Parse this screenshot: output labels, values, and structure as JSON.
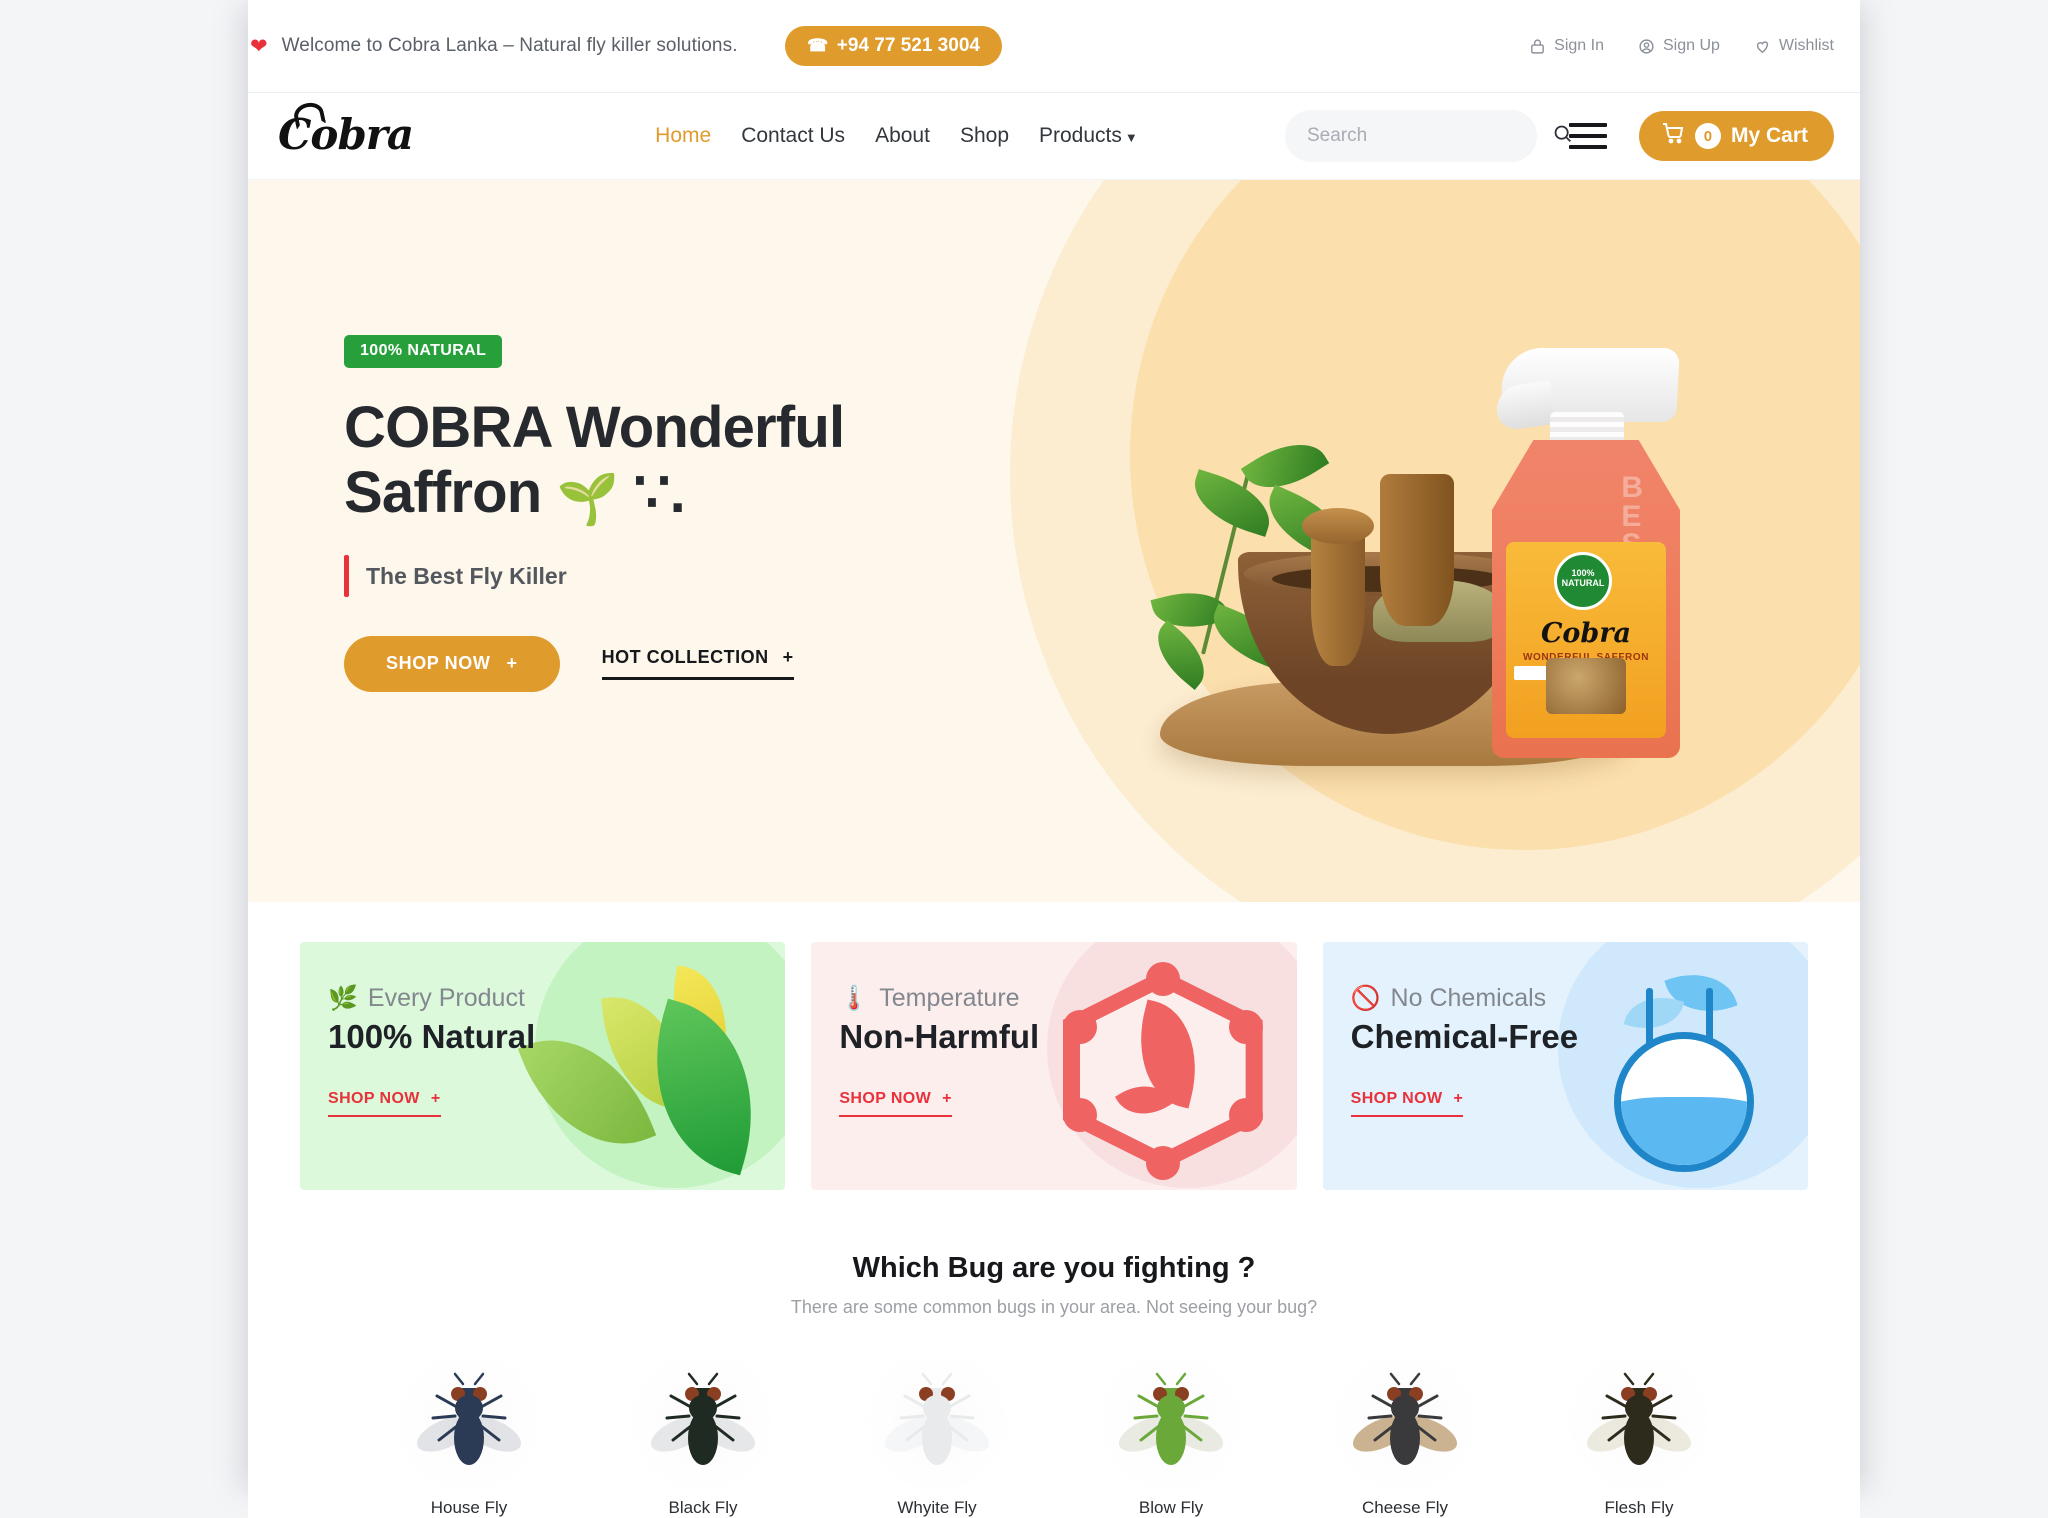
{
  "topbar": {
    "heart_icon": "heart-icon",
    "welcome": "Welcome to Cobra Lanka – Natural fly killer solutions.",
    "phone": "+94 77 521 3004",
    "links": [
      {
        "label": "Sign In",
        "icon": "lock-icon"
      },
      {
        "label": "Sign Up",
        "icon": "user-circle-icon"
      },
      {
        "label": "Wishlist",
        "icon": "heart-outline-icon"
      }
    ]
  },
  "nav": {
    "logo": "Cobra",
    "items": [
      {
        "label": "Home",
        "active": true
      },
      {
        "label": "Contact Us",
        "active": false
      },
      {
        "label": "About",
        "active": false
      },
      {
        "label": "Shop",
        "active": false
      },
      {
        "label": "Products",
        "active": false,
        "caret": "▼"
      }
    ],
    "products_caret": "▼",
    "search": {
      "placeholder": "Search",
      "value": "",
      "icon": "search-icon"
    },
    "menu_icon": "hamburger-icon",
    "cart": {
      "label": "My Cart",
      "count": "0",
      "icon": "cart-icon"
    }
  },
  "hero": {
    "badge": "100% NATURAL",
    "title_line1": "COBRA Wonderful",
    "title_line2": "Saffron",
    "title_emoji": "🌱",
    "title_suffix": "∵.",
    "subtitle": "The Best Fly Killer",
    "primary_cta": "SHOP NOW",
    "primary_cta_plus": "+",
    "secondary_cta": "HOT COLLECTION",
    "secondary_cta_plus": "+",
    "product": {
      "label_brand": "Cobra",
      "label_sub": "WONDERFUL SAFFRON",
      "label_badge": "100% NATURAL",
      "emboss": "BEST"
    }
  },
  "features": [
    {
      "kicker": "Every Product",
      "emoji": "🌿",
      "icon": "herb-icon",
      "title": "100% Natural",
      "cta": "SHOP NOW",
      "cta_plus": "+",
      "theme": "green",
      "art": "leaves-art"
    },
    {
      "kicker": "Temperature",
      "emoji": "🌡️",
      "icon": "thermometer-icon",
      "title": "Non-Harmful",
      "cta": "SHOP NOW",
      "cta_plus": "+",
      "theme": "pink",
      "art": "hexagon-leaf-art"
    },
    {
      "kicker": "No Chemicals",
      "emoji": "🚫",
      "icon": "no-entry-icon",
      "title": "Chemical-Free",
      "cta": "SHOP NOW",
      "cta_plus": "+",
      "theme": "blue",
      "art": "flask-art"
    }
  ],
  "bugs": {
    "title": "Which Bug are you fighting ?",
    "subtitle": "There are some common bugs in your area. Not seeing your bug?",
    "items": [
      {
        "label": "House Fly",
        "body": "#2b3a55",
        "wing": "#d8dadd"
      },
      {
        "label": "Black Fly",
        "body": "#1f2a22",
        "wing": "#dedfe0"
      },
      {
        "label": "Whyite Fly",
        "body": "#e8eaec",
        "wing": "#f2f3f4"
      },
      {
        "label": "Blow Fly",
        "body": "#6aa83a",
        "wing": "#e2e3d8"
      },
      {
        "label": "Cheese Fly",
        "body": "#3a3a3c",
        "wing": "#b99a6e"
      },
      {
        "label": "Flesh Fly",
        "body": "#2d2c1c",
        "wing": "#e6e3d3"
      }
    ]
  },
  "colors": {
    "accent": "#e09b2d",
    "red": "#e8313a",
    "green": "#27a03c",
    "hero_bg": "#fdf7ec"
  }
}
